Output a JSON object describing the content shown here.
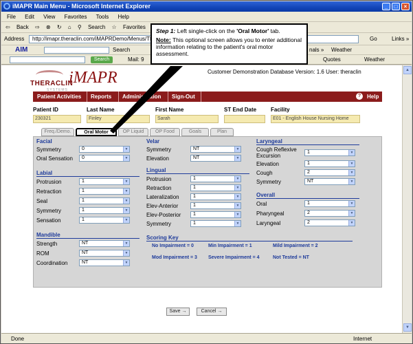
{
  "window": {
    "title": "iMAPR Main Menu - Microsoft Internet Explorer"
  },
  "menubar": [
    "File",
    "Edit",
    "View",
    "Favorites",
    "Tools",
    "Help"
  ],
  "toolbar": {
    "back": "Back",
    "search": "Search",
    "favorites": "Favorites"
  },
  "address": {
    "label": "Address",
    "url": "http://imapr.theraclin.com/iMAPRDemo/Menus/Thera",
    "go": "Go",
    "links": "Links »"
  },
  "aim_bar": {
    "aim": "AIM",
    "search": "Search",
    "sign": "nals »",
    "weather": "Weather"
  },
  "mail_bar": {
    "search_btn": "Search",
    "mail": "Mail: 9",
    "quotes": "Quotes",
    "weather": "Weather"
  },
  "status": {
    "left": "Done",
    "right": "Internet"
  },
  "app": {
    "logo_theraclin": "THERACLIN",
    "logo_imapr": "iMAPR",
    "logo_systems": "SYSTEMS",
    "db_line": "Customer Demonstration Database Version: 1.6 User: theraclin",
    "nav": [
      "Patient Activities",
      "Reports",
      "Administration",
      "Sign-Out"
    ],
    "help": "Help",
    "header": {
      "patient_id_label": "Patient ID",
      "patient_id": "230321",
      "last_name_label": "Last Name",
      "last_name": "Finley",
      "first_name_label": "First Name",
      "first_name": "Sarah",
      "st_end_label": "ST End Date",
      "st_end": "",
      "facility_label": "Facility",
      "facility": "E01 - English House Nursing Home"
    },
    "tabs": [
      "Freq./Demo.",
      "Oral Motor",
      "OP Liquid",
      "OP Food",
      "Goals",
      "Plan"
    ],
    "facial": {
      "title": "Facial",
      "rows": [
        {
          "label": "Symmetry",
          "value": "0"
        },
        {
          "label": "Oral Sensation",
          "value": "0"
        }
      ]
    },
    "labial": {
      "title": "Labial",
      "rows": [
        {
          "label": "Protrusion",
          "value": "1"
        },
        {
          "label": "Retraction",
          "value": "1"
        },
        {
          "label": "Seal",
          "value": "1"
        },
        {
          "label": "Symmetry",
          "value": "1"
        },
        {
          "label": "Sensation",
          "value": "1"
        }
      ]
    },
    "mandible": {
      "title": "Mandible",
      "rows": [
        {
          "label": "Strength",
          "value": "NT"
        },
        {
          "label": "ROM",
          "value": "NT"
        },
        {
          "label": "Coordination",
          "value": "NT"
        }
      ]
    },
    "velar": {
      "title": "Velar",
      "rows": [
        {
          "label": "Symmetry",
          "value": "NT"
        },
        {
          "label": "Elevation",
          "value": "NT"
        }
      ]
    },
    "lingual": {
      "title": "Lingual",
      "rows": [
        {
          "label": "Protrusion",
          "value": "1"
        },
        {
          "label": "Retraction",
          "value": "1"
        },
        {
          "label": "Lateralization",
          "value": "1"
        },
        {
          "label": "Elev-Anterior",
          "value": "1"
        },
        {
          "label": "Elev-Posterior",
          "value": "1"
        },
        {
          "label": "Symmetry",
          "value": "1"
        }
      ]
    },
    "laryngeal": {
      "title": "Laryngeal",
      "rows": [
        {
          "label": "Cough Reflexive Excursion",
          "value": "1"
        },
        {
          "label": "Elevation",
          "value": "1"
        },
        {
          "label": "Cough",
          "value": "2"
        },
        {
          "label": "Symmetry",
          "value": "NT"
        }
      ]
    },
    "overall": {
      "title": "Overall",
      "rows": [
        {
          "label": "Oral",
          "value": "1"
        },
        {
          "label": "Pharyngeal",
          "value": "2"
        },
        {
          "label": "Laryngeal",
          "value": "2"
        }
      ]
    },
    "scoring": {
      "title": "Scoring Key",
      "row1": [
        "No Impairment = 0",
        "Min Impairment = 1",
        "Mild Impairment = 2"
      ],
      "row2": [
        "Mod Impairment = 3",
        "Severe Impairment = 4",
        "Not Tested = NT"
      ]
    },
    "buttons": {
      "save": "Save →",
      "cancel": "Cancel →"
    }
  },
  "callout": {
    "step": "Step 1:",
    "step_text": "Left single-click on the",
    "step_target": "'Oral Motor'",
    "step_end": "tab.",
    "note": "Note:",
    "note_text": "This optional screen allows you to enter additional information relating to the patient's oral motor assessment."
  }
}
